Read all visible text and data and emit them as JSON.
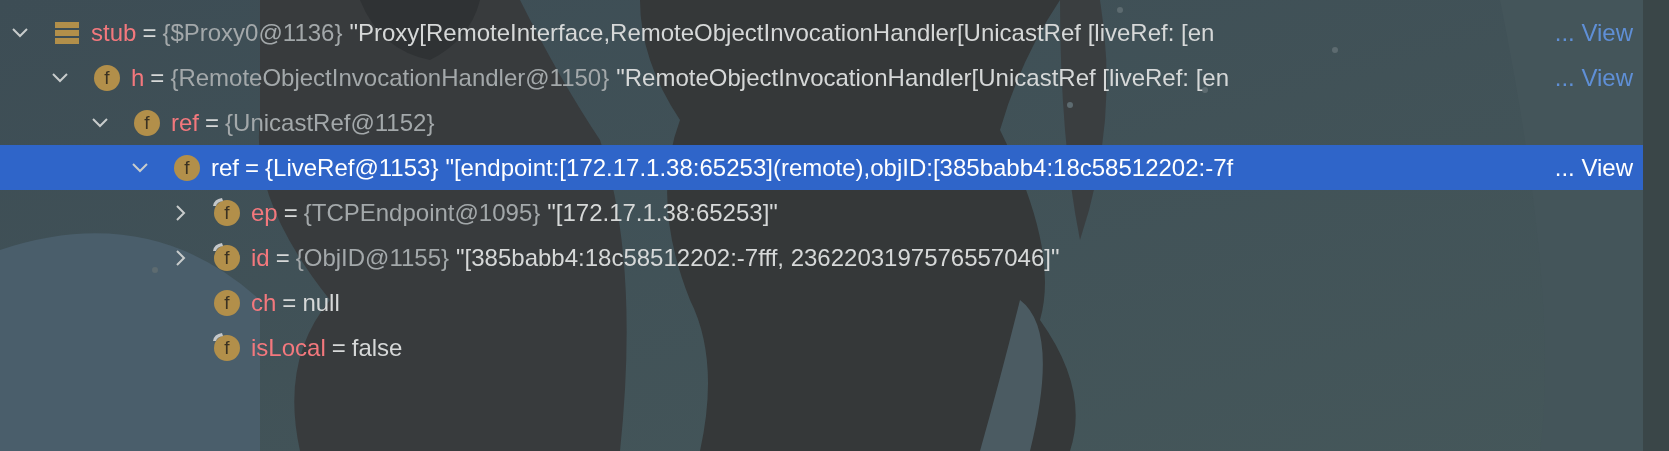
{
  "tree": [
    {
      "kind": "object",
      "name": "stub",
      "operator": "=",
      "type": "{$Proxy0@1136}",
      "value": "\"Proxy[RemoteInterface,RemoteObjectInvocationHandler[UnicastRef [liveRef: [en",
      "link": "... View",
      "expanded": true,
      "selected": false,
      "children": [
        {
          "kind": "field",
          "badge": "f",
          "final": false,
          "name": "h",
          "operator": "=",
          "type": "{RemoteObjectInvocationHandler@1150}",
          "value": "\"RemoteObjectInvocationHandler[UnicastRef [liveRef: [en",
          "link": "... View",
          "expanded": true,
          "selected": false,
          "children": [
            {
              "kind": "field",
              "badge": "f",
              "final": false,
              "name": "ref",
              "operator": "=",
              "type": "{UnicastRef@1152}",
              "expanded": true,
              "selected": false,
              "children": [
                {
                  "kind": "field",
                  "badge": "f",
                  "final": false,
                  "name": "ref",
                  "operator": "=",
                  "type": "{LiveRef@1153}",
                  "value": "\"[endpoint:[172.17.1.38:65253](remote),objID:[385babb4:18c58512202:-7f",
                  "link": "... View",
                  "expanded": true,
                  "selected": true,
                  "children": [
                    {
                      "kind": "field",
                      "badge": "f",
                      "final": true,
                      "name": "ep",
                      "operator": "=",
                      "type": "{TCPEndpoint@1095}",
                      "value": "\"[172.17.1.38:65253]\"",
                      "expanded": false,
                      "selected": false
                    },
                    {
                      "kind": "field",
                      "badge": "f",
                      "final": true,
                      "name": "id",
                      "operator": "=",
                      "type": "{ObjID@1155}",
                      "value": "\"[385babb4:18c58512202:-7fff, 2362203197576557046]\"",
                      "expanded": false,
                      "selected": false
                    },
                    {
                      "kind": "field",
                      "badge": "f",
                      "final": false,
                      "name": "ch",
                      "operator": "=",
                      "value": "null",
                      "selected": false
                    },
                    {
                      "kind": "field",
                      "badge": "f",
                      "final": true,
                      "name": "isLocal",
                      "operator": "=",
                      "value": "false",
                      "selected": false
                    }
                  ]
                }
              ]
            }
          ]
        }
      ]
    }
  ]
}
